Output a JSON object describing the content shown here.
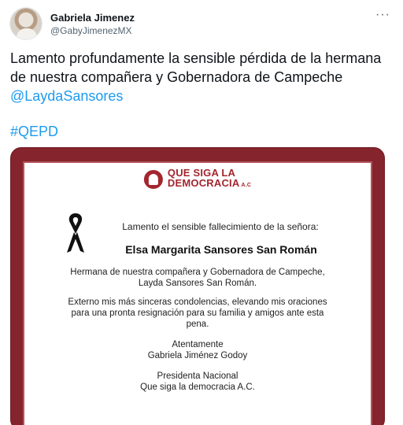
{
  "user": {
    "display_name": "Gabriela Jimenez",
    "handle": "@GabyJimenezMX"
  },
  "more_label": "···",
  "tweet": {
    "text_before_mention": "Lamento profundamente la sensible pérdida de la hermana de nuestra compañera y Gobernadora de Campeche ",
    "mention": "@LaydaSansores",
    "hashtag": "#QEPD"
  },
  "card": {
    "logo_line1": "QUE SIGA LA",
    "logo_line2": "DEMOCRACIA",
    "logo_suffix": "A.C",
    "lead": "Lamento el sensible fallecimiento de la señora:",
    "deceased_name": "Elsa Margarita Sansores San Román",
    "paragraph1_line1": "Hermana de nuestra compañera y Gobernadora de Campeche,",
    "paragraph1_line2": "Layda Sansores San Román.",
    "paragraph2_line1": "Externo mis más sinceras condolencias, elevando mis oraciones",
    "paragraph2_line2": "para una pronta resignación para su familia y amigos ante esta",
    "paragraph2_line3": "pena.",
    "closing_line1": "Atentamente",
    "closing_line2": "Gabriela Jiménez Godoy",
    "title_line1": "Presidenta Nacional",
    "title_line2": "Que siga la democracia A.C."
  },
  "colors": {
    "link": "#1d9bf0",
    "frame": "#85242c",
    "brand": "#a3262e"
  },
  "icons": {
    "avatar": "user-avatar",
    "more": "more-options-icon",
    "ribbon": "mourning-ribbon-icon",
    "logo": "que-siga-la-democracia-logo"
  }
}
